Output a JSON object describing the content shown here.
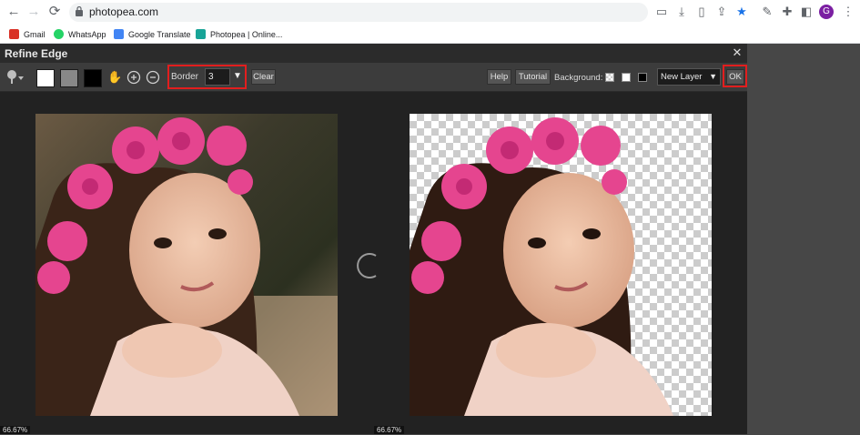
{
  "browser": {
    "url": "photopea.com",
    "avatar_letter": "G",
    "bookmarks": [
      {
        "label": "Gmail",
        "icon": "gmail-icon",
        "color": "#d93025"
      },
      {
        "label": "WhatsApp",
        "icon": "whatsapp-icon",
        "color": "#25d366"
      },
      {
        "label": "Google Translate",
        "icon": "google-translate-icon",
        "color": "#4285f4"
      },
      {
        "label": "Photopea | Online...",
        "icon": "photopea-icon",
        "color": "#18a497"
      }
    ]
  },
  "dialog": {
    "title": "Refine Edge",
    "close_symbol": "✕",
    "toolbar": {
      "brush_icon": "refine-brush-icon",
      "swatches": [
        "#ffffff",
        "#888888",
        "#000000"
      ],
      "hand_icon": "hand-icon",
      "zoom_in_icon": "zoom-in-icon",
      "zoom_out_icon": "zoom-out-icon",
      "border_label": "Border",
      "border_value": "3",
      "clear_label": "Clear",
      "help_label": "Help",
      "tutorial_label": "Tutorial",
      "background_label": "Background:",
      "background_options": [
        "checkerboard",
        "#ffffff",
        "#000000"
      ],
      "output_select": "New Layer",
      "ok_label": "OK"
    },
    "left_preview": {
      "zoom": "66.67%"
    },
    "right_preview": {
      "zoom": "66.67%"
    },
    "highlight_color": "#e21e1e"
  }
}
